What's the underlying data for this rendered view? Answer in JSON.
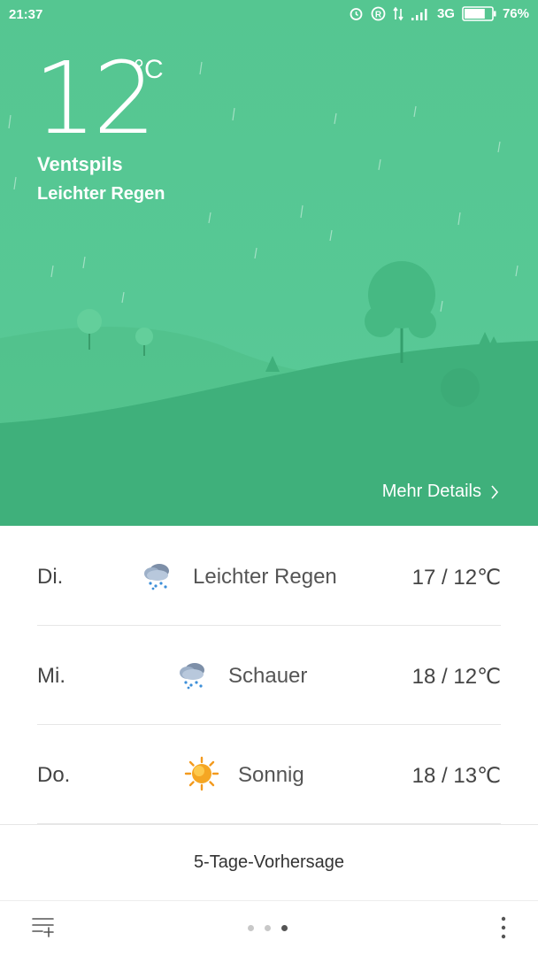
{
  "status_bar": {
    "time": "21:37",
    "network": "3G",
    "battery": "76%",
    "battery_level": 0.76,
    "icons": [
      "alarm-icon",
      "registered-icon",
      "data-arrows-icon",
      "signal-icon",
      "battery-icon"
    ]
  },
  "current": {
    "temperature": "12",
    "unit": "°C",
    "city": "Ventspils",
    "condition": "Leichter Regen",
    "details_link": "Mehr Details"
  },
  "forecast": [
    {
      "day": "Di.",
      "icon": "rain-cloud-icon",
      "condition": "Leichter Regen",
      "range": "17 / 12℃"
    },
    {
      "day": "Mi.",
      "icon": "rain-cloud-icon",
      "condition": "Schauer",
      "range": "18 / 12℃"
    },
    {
      "day": "Do.",
      "icon": "sun-icon",
      "condition": "Sonnig",
      "range": "18 / 13℃"
    }
  ],
  "five_day_label": "5-Tage-Vorhersage",
  "pager": {
    "count": 3,
    "active": 3
  },
  "colors": {
    "hero": "#57c895",
    "hills_far": "#4fbd86",
    "hills_near": "#3fb07b",
    "text_dark": "#444444"
  }
}
